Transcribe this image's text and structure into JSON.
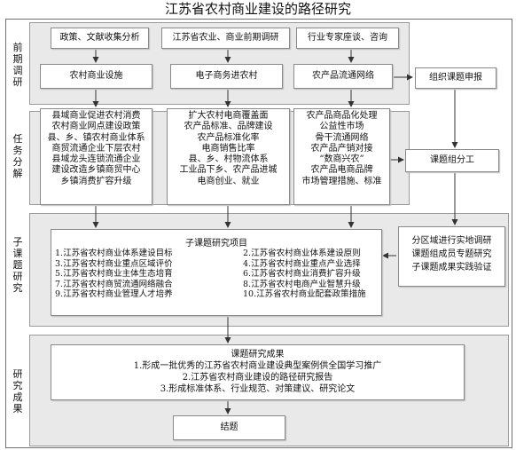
{
  "title": "江苏省农村商业建设的路径研究",
  "sections": {
    "s1": "前期调研",
    "s2": "任务分解",
    "s3": "子课题研究",
    "s4": "研究成果"
  },
  "row1": [
    "政策、文献收集分析",
    "江苏省农业、商业前期调研",
    "行业专家座谈、咨询"
  ],
  "row2": [
    "农村商业设施",
    "电子商务进农村",
    "农产品流通网络"
  ],
  "side_boxes": {
    "apply": "组织课题申报",
    "team": "课题组分工"
  },
  "tasks": {
    "left": [
      "县域商业促进农村消费",
      "农村商业网点建设政策",
      "县、乡、镇农村商业体系",
      "商贸流通企业下层农村",
      "县域龙头连锁流通企业",
      "建设改造乡镇商贸中心",
      "乡镇消费扩容升级"
    ],
    "mid": [
      "扩大农村电商覆盖面",
      "农产品标准、品牌建设",
      "农产品标准化率",
      "电商销售比率",
      "县、乡、村物流体系",
      "工业品下乡、农产品进城",
      "电商创业、就业"
    ],
    "right": [
      "农产品商品化处理",
      "公益性市场",
      "骨干流通网络",
      "农产品产销对接",
      "“数商兴农”",
      "农产品电商品牌",
      "市场管理措施、标准"
    ]
  },
  "subtopics": {
    "heading": "子课题研究项目",
    "left": [
      "1.江苏省农村商业体系建设目标",
      "3.江苏省农村商业重点区域评价",
      "5.江苏省农村商业主体生态培育",
      "7.江苏省农村商贸流通网络融合",
      "9.江苏省农村商业管理人才培养"
    ],
    "right": [
      "2.江苏省农村商业体系建设原则",
      "4.江苏省农村商业重点产业选择",
      "6.江苏省农村商业消费扩容升级",
      "8.江苏省农村电商产业智慧升级",
      "10.江苏省农村商业配套政策措施"
    ]
  },
  "validation": [
    "分区域进行实地调研",
    "课题组成员专题研究",
    "子课题成果实践验证"
  ],
  "results": {
    "heading": "课题研究成果",
    "items": [
      "1.形成一批优秀的江苏省农村商业建设典型案例供全国学习推广",
      "2.江苏省农村商业建设的路径研究报告",
      "3.形成标准体系、行业规范、对策建议、研究论文"
    ]
  },
  "conclusion": "结题"
}
